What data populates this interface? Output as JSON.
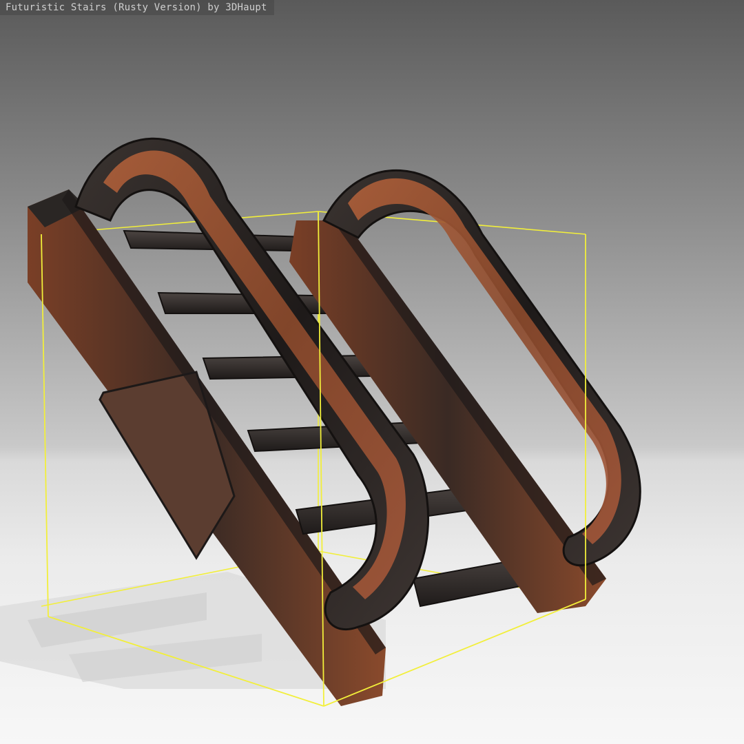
{
  "viewer": {
    "title": "Futuristic Stairs (Rusty Version) by 3DHaupt"
  },
  "model": {
    "name": "Futuristic Stairs (Rusty Version)",
    "bounding_box_color": "#f2ef3a"
  },
  "colors": {
    "rust": "#9a4e2d",
    "dark_metal": "#2a2624",
    "steel": "#4a4644"
  }
}
